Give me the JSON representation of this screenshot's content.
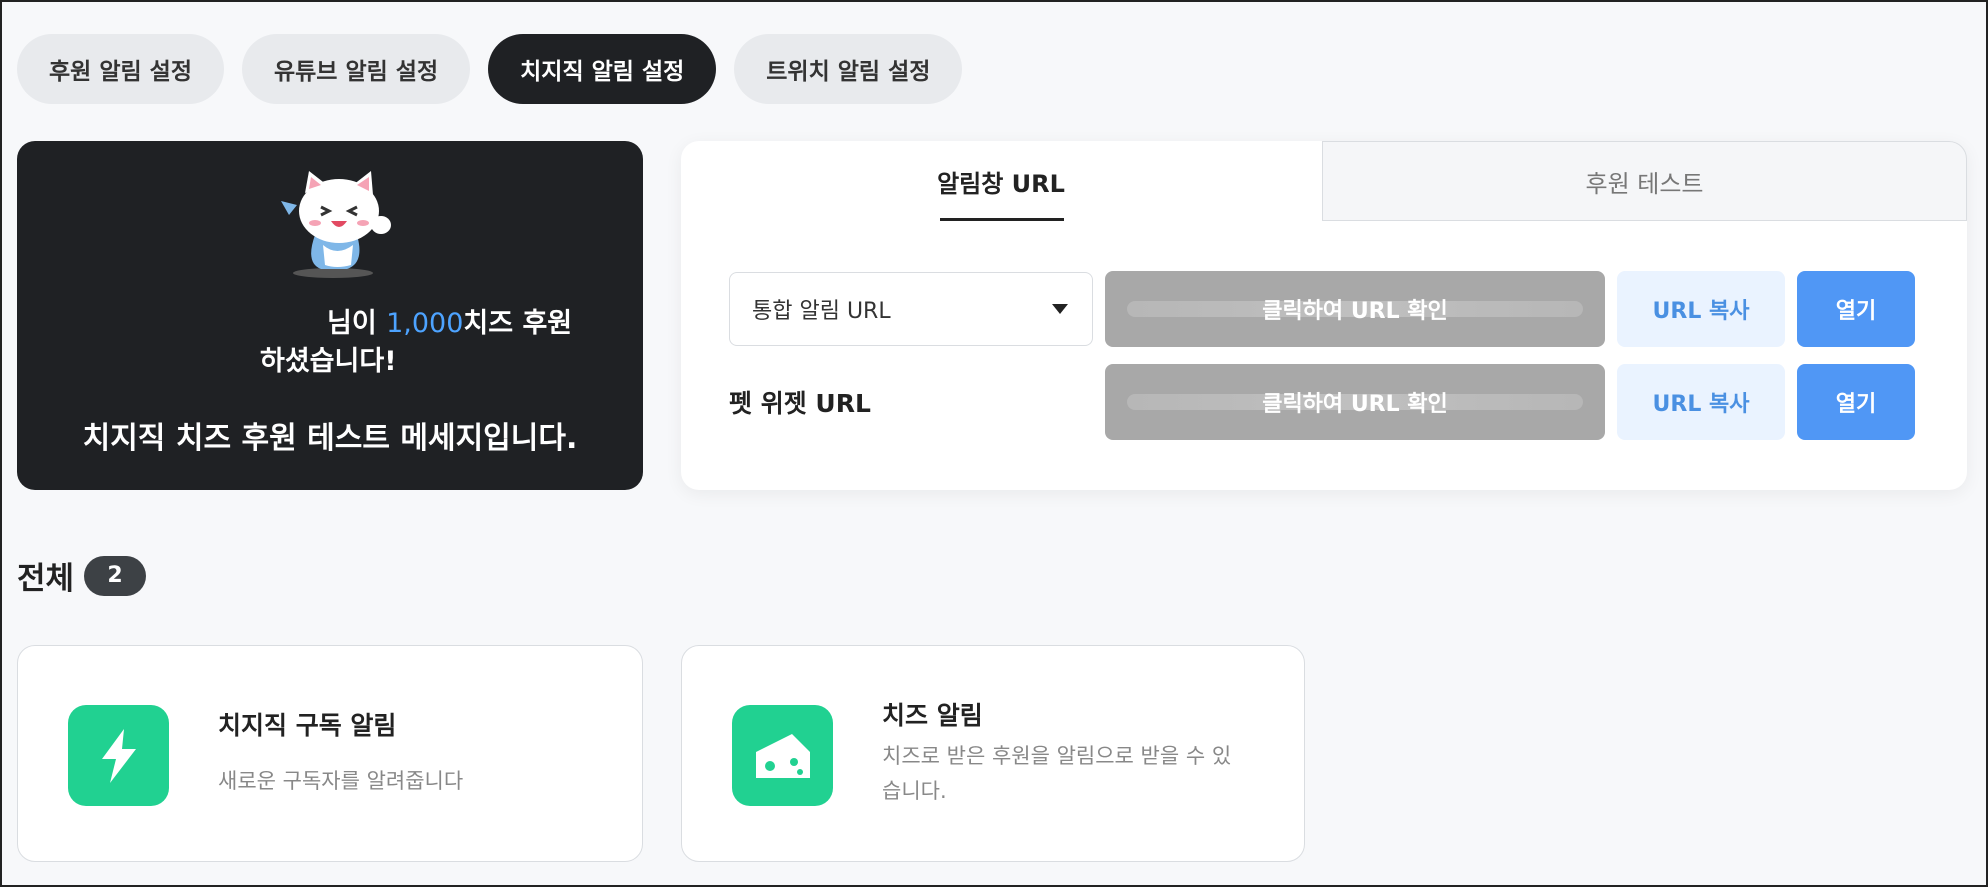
{
  "tabs": [
    {
      "label": "후원 알림 설정",
      "active": false
    },
    {
      "label": "유튜브 알림 설정",
      "active": false
    },
    {
      "label": "치지직 알림 설정",
      "active": true
    },
    {
      "label": "트위치 알림 설정",
      "active": false
    }
  ],
  "preview": {
    "line1_suffix": "님이 ",
    "amount": "1,000",
    "line1_end": "치즈 후원",
    "line2": "하셨습니다!",
    "message": "치지직 치즈 후원 테스트 메세지입니다."
  },
  "panel": {
    "tab_url": "알림창 URL",
    "tab_test": "후원 테스트",
    "rows": [
      {
        "select_label": "통합 알림 URL",
        "url_text": "클릭하여 URL 확인",
        "copy": "URL 복사",
        "open": "열기"
      },
      {
        "label": "펫 위젯 URL",
        "url_text": "클릭하여 URL 확인",
        "copy": "URL 복사",
        "open": "열기"
      }
    ]
  },
  "list": {
    "title": "전체",
    "count": "2",
    "items": [
      {
        "name": "치지직 구독 알림",
        "desc": "새로운 구독자를 알려줍니다",
        "icon": "lightning-icon",
        "color": "#21d191"
      },
      {
        "name": "치즈 알림",
        "desc_line1": "치즈로 받은 후원을 알림으로 받을 수 있",
        "desc_line2": "습니다.",
        "icon": "cheese-icon",
        "color": "#21d191"
      }
    ]
  }
}
